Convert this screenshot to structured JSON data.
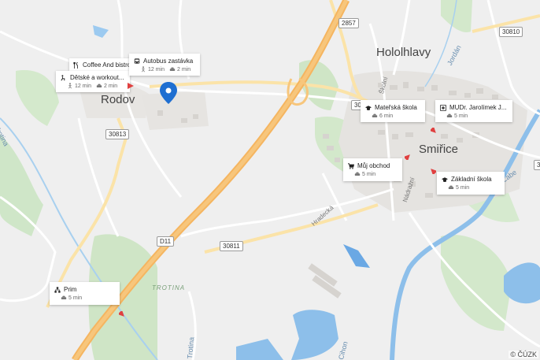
{
  "map": {
    "towns": [
      {
        "id": "hololhlavy",
        "text": "Hololhlavy"
      },
      {
        "id": "rodov",
        "text": "Rodov"
      },
      {
        "id": "smirice",
        "text": "Smiřice"
      }
    ],
    "waters": [
      {
        "id": "trotina-1",
        "text": "Trotina"
      },
      {
        "id": "trotina-2",
        "text": "Trotina"
      },
      {
        "id": "jordan",
        "text": "Jordán"
      },
      {
        "id": "labe",
        "text": "Labe"
      },
      {
        "id": "cihon",
        "text": "Cihon"
      }
    ],
    "streets": [
      {
        "id": "hradecka",
        "text": "Hradecká"
      },
      {
        "id": "nadrazni",
        "text": "Nádražní"
      },
      {
        "id": "skolni",
        "text": "Školní"
      }
    ],
    "road_shields": [
      {
        "id": "r2857",
        "text": "2857"
      },
      {
        "id": "r30810",
        "text": "30810"
      },
      {
        "id": "r30813",
        "text": "30813"
      },
      {
        "id": "r30811",
        "text": "30811"
      },
      {
        "id": "d11",
        "text": "D11"
      },
      {
        "id": "r30",
        "text": "30"
      },
      {
        "id": "r3-right",
        "text": "3"
      }
    ],
    "terrain_label": "TROTINA",
    "pin_color": "#1f6fd1",
    "copyright": "© ČÚZK"
  },
  "pois": [
    {
      "id": "coffee",
      "icon": "cutlery-icon",
      "name": "Coffee And bistro",
      "walk": "",
      "drive": ""
    },
    {
      "id": "workout",
      "icon": "exercise-icon",
      "name": "Dětské a workout...",
      "walk": "12 min",
      "drive": "2 min"
    },
    {
      "id": "bus",
      "icon": "bus-icon",
      "name": "Autobus zastávka",
      "walk": "12 min",
      "drive": "2 min"
    },
    {
      "id": "materska",
      "icon": "school-icon",
      "name": "Mateřská škola",
      "walk": "",
      "drive": "6 min"
    },
    {
      "id": "mudr",
      "icon": "medical-icon",
      "name": "MUDr. Jarolímek J...",
      "walk": "",
      "drive": "5 min"
    },
    {
      "id": "obchod",
      "icon": "cart-icon",
      "name": "Můj obchod",
      "walk": "",
      "drive": "5 min"
    },
    {
      "id": "zakladni",
      "icon": "school-icon",
      "name": "Základní škola",
      "walk": "",
      "drive": "5 min"
    },
    {
      "id": "prim",
      "icon": "network-icon",
      "name": "Prim",
      "walk": "",
      "drive": "5 min"
    }
  ]
}
